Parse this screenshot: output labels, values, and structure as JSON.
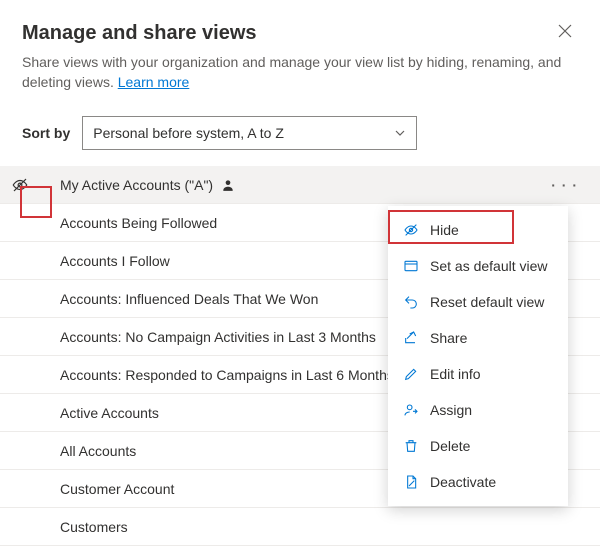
{
  "title": "Manage and share views",
  "subtitle_prefix": "Share views with your organization and manage your view list by hiding, renaming, and deleting views. ",
  "learn_more": "Learn more",
  "sort_by_label": "Sort by",
  "sort_by_value": "Personal before system, A to Z",
  "rows": [
    {
      "label": "My Active Accounts (\"A\")",
      "personal": true
    },
    {
      "label": "Accounts Being Followed"
    },
    {
      "label": "Accounts I Follow"
    },
    {
      "label": "Accounts: Influenced Deals That We Won"
    },
    {
      "label": "Accounts: No Campaign Activities in Last 3 Months"
    },
    {
      "label": "Accounts: Responded to Campaigns in Last 6 Months"
    },
    {
      "label": "Active Accounts"
    },
    {
      "label": "All Accounts"
    },
    {
      "label": "Customer Account"
    },
    {
      "label": "Customers"
    }
  ],
  "menu": {
    "hide": "Hide",
    "set_default": "Set as default view",
    "reset_default": "Reset default view",
    "share": "Share",
    "edit_info": "Edit info",
    "assign": "Assign",
    "delete": "Delete",
    "deactivate": "Deactivate"
  }
}
